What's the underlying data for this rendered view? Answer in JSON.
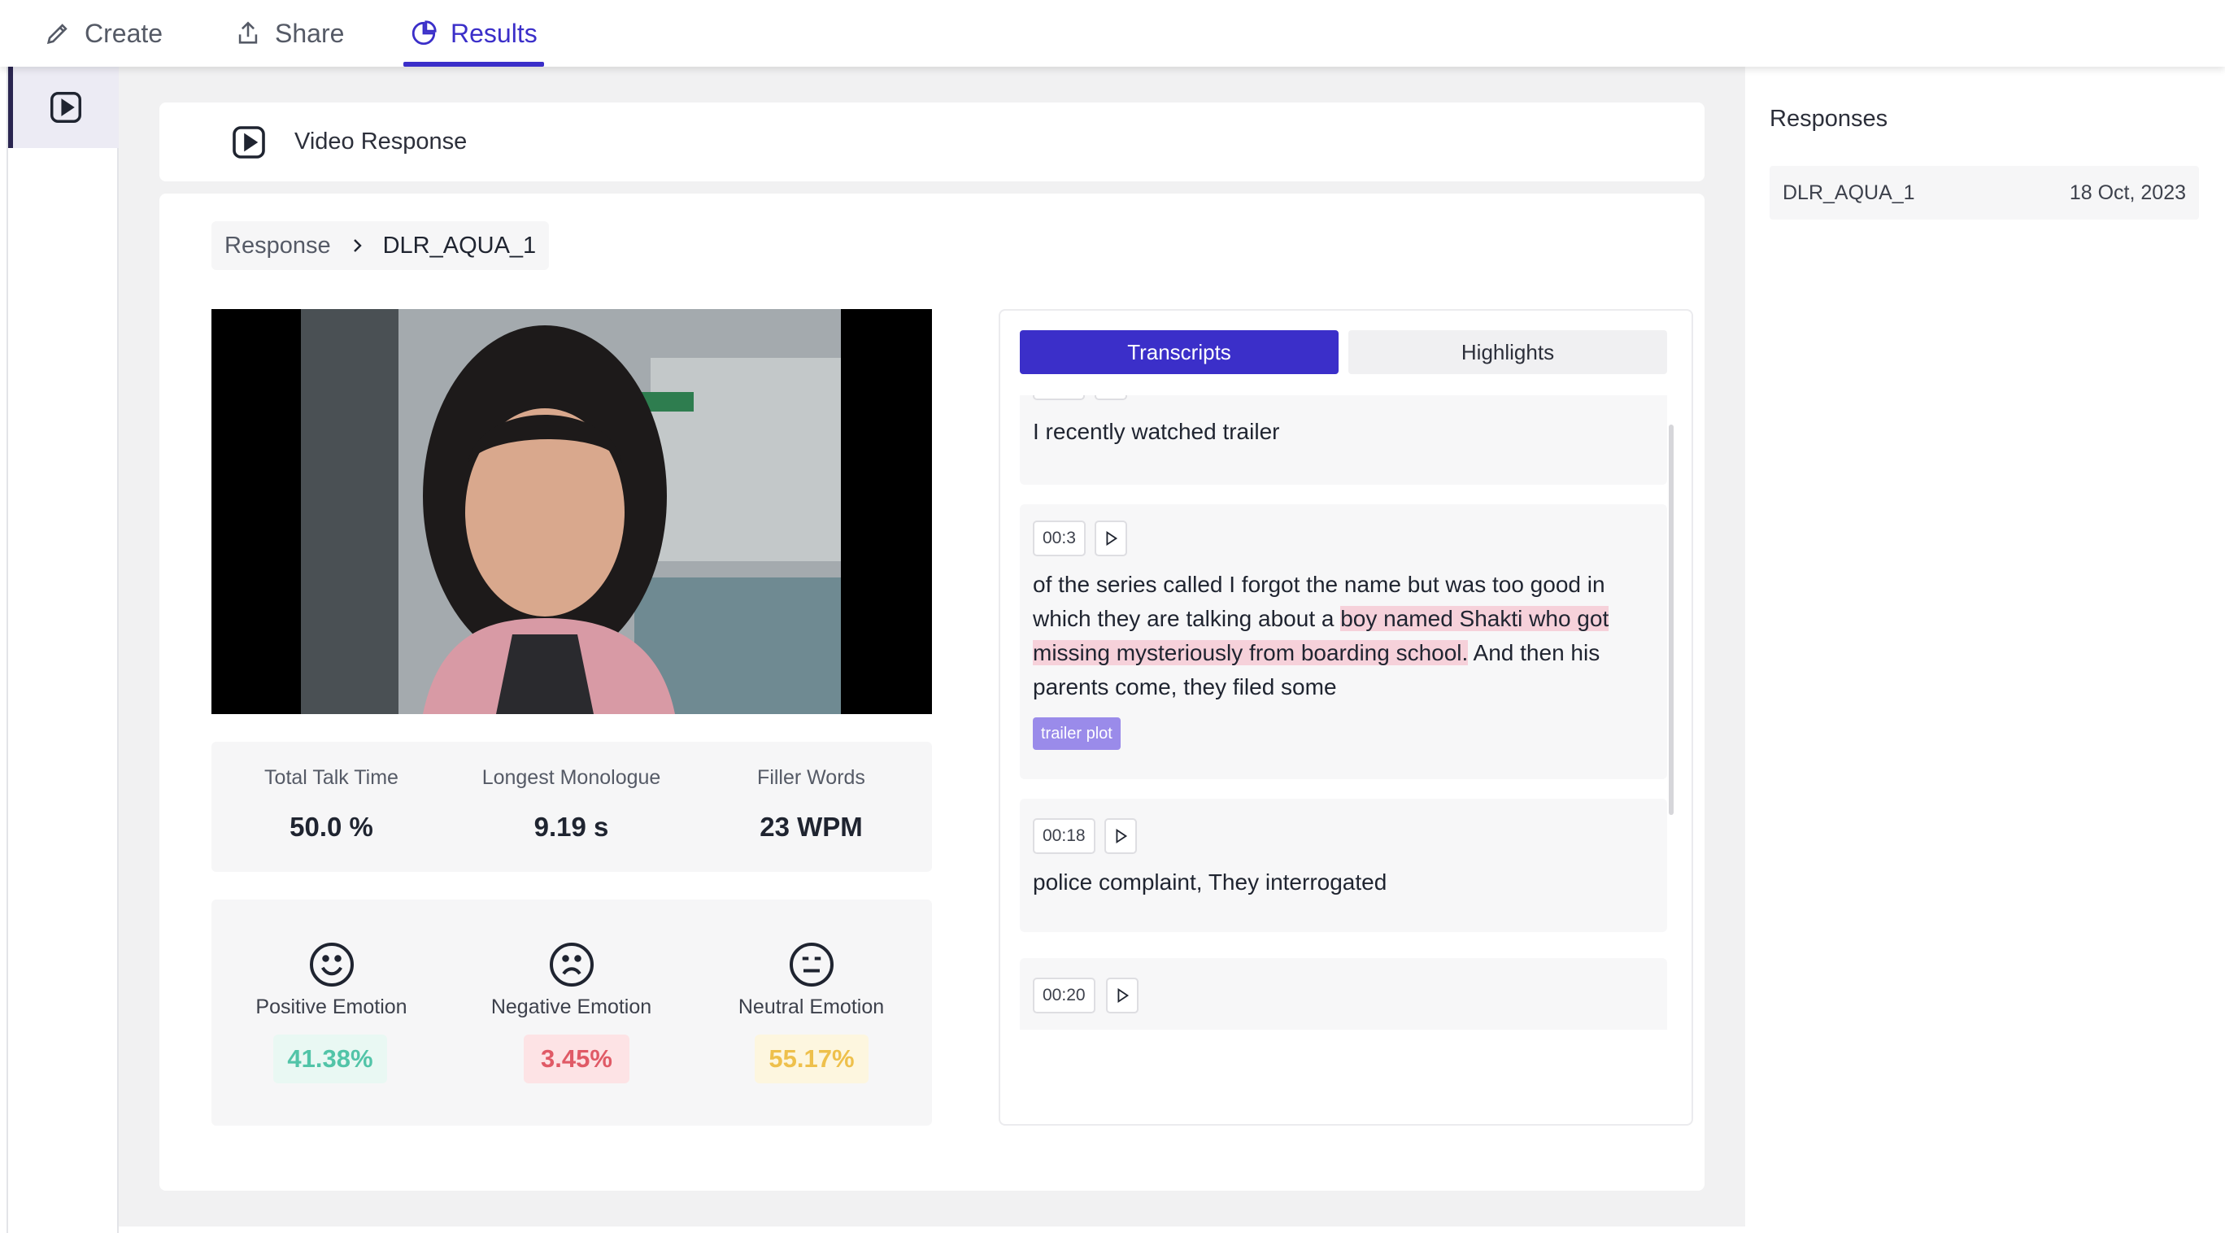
{
  "nav": {
    "tabs": [
      {
        "label": "Create",
        "icon": "pencil-icon"
      },
      {
        "label": "Share",
        "icon": "share-icon"
      },
      {
        "label": "Results",
        "icon": "pie-chart-icon",
        "active": true
      }
    ]
  },
  "rail": {
    "icon": "play-square-icon"
  },
  "header": {
    "title": "Video Response",
    "icon": "play-square-icon"
  },
  "breadcrumb": {
    "parent": "Response",
    "current": "DLR_AQUA_1"
  },
  "stats": [
    {
      "label": "Total Talk Time",
      "value": "50.0 %"
    },
    {
      "label": "Longest Monologue",
      "value": "9.19 s"
    },
    {
      "label": "Filler Words",
      "value": "23 WPM"
    }
  ],
  "emotions": [
    {
      "label": "Positive Emotion",
      "value": "41.38%",
      "icon": "smile-icon",
      "color": "#52c4a8",
      "bg": "#e9f8f3"
    },
    {
      "label": "Negative Emotion",
      "value": "3.45%",
      "icon": "frown-icon",
      "color": "#e05a66",
      "bg": "#fde3e5"
    },
    {
      "label": "Neutral Emotion",
      "value": "55.17%",
      "icon": "neutral-face-icon",
      "color": "#eec04c",
      "bg": "#fdf6df"
    }
  ],
  "transcript_tabs": {
    "transcripts": "Transcripts",
    "highlights": "Highlights"
  },
  "transcripts": [
    {
      "time": "",
      "text": "I recently watched trailer"
    },
    {
      "time": "00:3",
      "text_before": "of the series called I forgot the name but was too good in which they are talking about a ",
      "highlight": "boy named Shakti who got missing mysteriously from boarding school.",
      "text_after": " And then his parents come, they filed some",
      "tag": "trailer plot"
    },
    {
      "time": "00:18",
      "text": "police complaint, They interrogated"
    },
    {
      "time": "00:20",
      "text": ""
    }
  ],
  "responses": {
    "title": "Responses",
    "items": [
      {
        "name": "DLR_AQUA_1",
        "date": "18 Oct, 2023"
      }
    ]
  },
  "colors": {
    "accent": "#3b2fc9",
    "highlight": "#f6d1da",
    "tag": "#9a8bea"
  }
}
